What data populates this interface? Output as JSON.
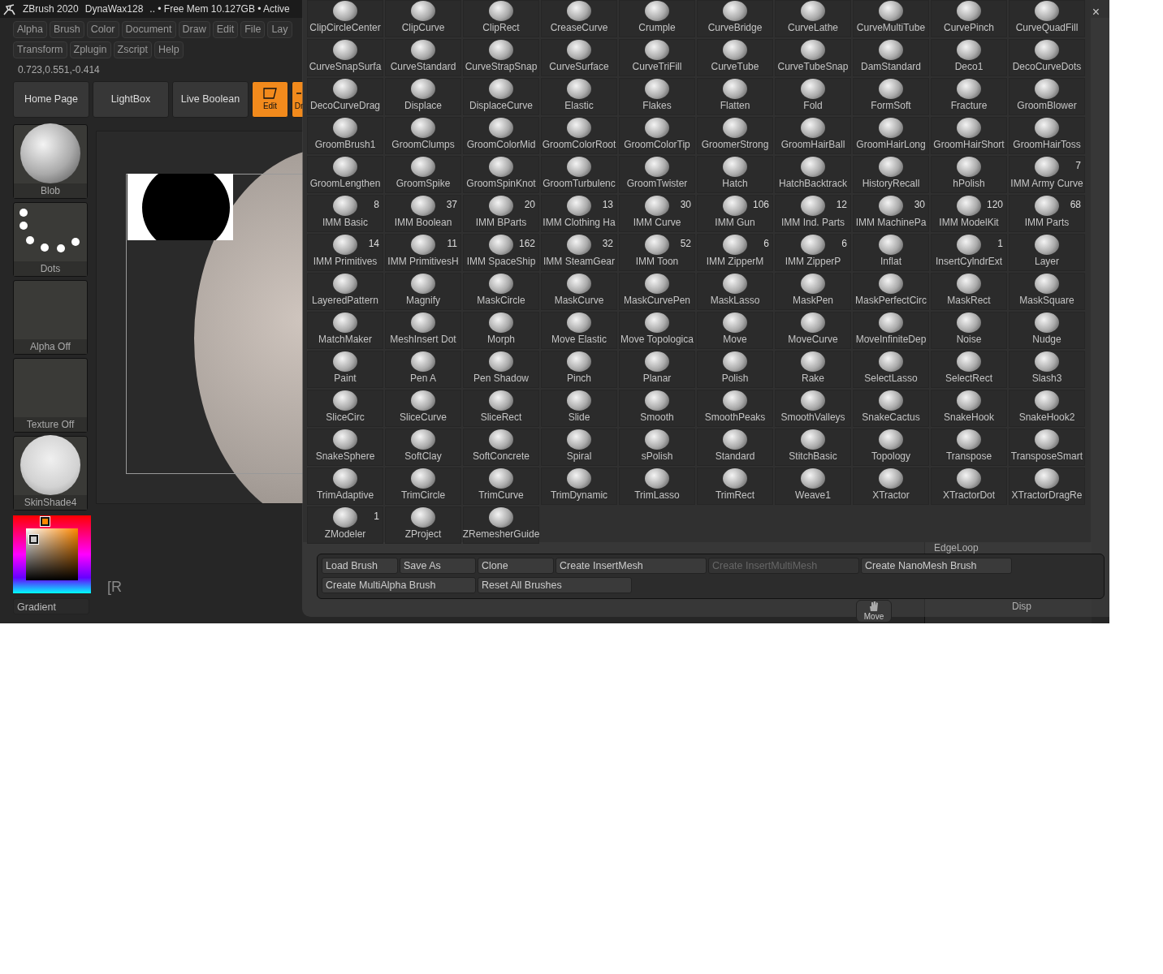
{
  "title_bar": {
    "app": "ZBrush 2020",
    "file": "DynaWax128",
    "status": ".. • Free Mem 10.127GB • Active"
  },
  "menu_rows": [
    {
      "items": [
        "Alpha",
        "Brush",
        "Color",
        "Document",
        "Draw",
        "Edit",
        "File",
        "Lay"
      ]
    },
    {
      "items": [
        "Transform",
        "Zplugin",
        "Zscript",
        "Help"
      ]
    }
  ],
  "coordinates": "0.723,0.551,-0.414",
  "toolbar": [
    {
      "label": "Home Page",
      "kind": "text",
      "selected": false
    },
    {
      "label": "LightBox",
      "kind": "text",
      "selected": false
    },
    {
      "label": "Live Boolean",
      "kind": "text",
      "selected": false
    },
    {
      "label": "Edit",
      "kind": "edit",
      "selected": true
    },
    {
      "label": "Dr",
      "kind": "draw",
      "selected": true
    }
  ],
  "tray": [
    {
      "label": "Blob",
      "kind": "material"
    },
    {
      "label": "Dots",
      "kind": "dots"
    },
    {
      "label": "Alpha Off",
      "kind": "empty"
    },
    {
      "label": "Texture Off",
      "kind": "empty"
    },
    {
      "label": "SkinShade4",
      "kind": "smooth"
    }
  ],
  "color_picker": {
    "label": "Gradient"
  },
  "canvas": {
    "note": "[R"
  },
  "brush_palette": {
    "brushes": [
      {
        "name": "ClipCircleCenter"
      },
      {
        "name": "ClipCurve"
      },
      {
        "name": "ClipRect"
      },
      {
        "name": "CreaseCurve"
      },
      {
        "name": "Crumple"
      },
      {
        "name": "CurveBridge"
      },
      {
        "name": "CurveLathe"
      },
      {
        "name": "CurveMultiTube"
      },
      {
        "name": "CurvePinch"
      },
      {
        "name": "CurveQuadFill"
      },
      {
        "name": "CurveSnapSurfa"
      },
      {
        "name": "CurveStandard"
      },
      {
        "name": "CurveStrapSnap"
      },
      {
        "name": "CurveSurface"
      },
      {
        "name": "CurveTriFill"
      },
      {
        "name": "CurveTube"
      },
      {
        "name": "CurveTubeSnap"
      },
      {
        "name": "DamStandard"
      },
      {
        "name": "Deco1"
      },
      {
        "name": "DecoCurveDots"
      },
      {
        "name": "DecoCurveDrag"
      },
      {
        "name": "Displace"
      },
      {
        "name": "DisplaceCurve"
      },
      {
        "name": "Elastic"
      },
      {
        "name": "Flakes"
      },
      {
        "name": "Flatten"
      },
      {
        "name": "Fold"
      },
      {
        "name": "FormSoft"
      },
      {
        "name": "Fracture"
      },
      {
        "name": "GroomBlower"
      },
      {
        "name": "GroomBrush1"
      },
      {
        "name": "GroomClumps"
      },
      {
        "name": "GroomColorMid"
      },
      {
        "name": "GroomColorRoot"
      },
      {
        "name": "GroomColorTip"
      },
      {
        "name": "GroomerStrong"
      },
      {
        "name": "GroomHairBall"
      },
      {
        "name": "GroomHairLong"
      },
      {
        "name": "GroomHairShort"
      },
      {
        "name": "GroomHairToss"
      },
      {
        "name": "GroomLengthen"
      },
      {
        "name": "GroomSpike"
      },
      {
        "name": "GroomSpinKnot"
      },
      {
        "name": "GroomTurbulenc"
      },
      {
        "name": "GroomTwister"
      },
      {
        "name": "Hatch"
      },
      {
        "name": "HatchBacktrack"
      },
      {
        "name": "HistoryRecall"
      },
      {
        "name": "hPolish"
      },
      {
        "name": "IMM Army Curve",
        "count": "7"
      },
      {
        "name": "IMM Basic",
        "count": "8"
      },
      {
        "name": "IMM Boolean",
        "count": "37"
      },
      {
        "name": "IMM BParts",
        "count": "20"
      },
      {
        "name": "IMM Clothing Ha",
        "count": "13"
      },
      {
        "name": "IMM Curve",
        "count": "30"
      },
      {
        "name": "IMM Gun",
        "count": "106"
      },
      {
        "name": "IMM Ind. Parts",
        "count": "12"
      },
      {
        "name": "IMM MachinePa",
        "count": "30"
      },
      {
        "name": "IMM ModelKit",
        "count": "120"
      },
      {
        "name": "IMM Parts",
        "count": "68"
      },
      {
        "name": "IMM Primitives",
        "count": "14"
      },
      {
        "name": "IMM PrimitivesH",
        "count": "11"
      },
      {
        "name": "IMM SpaceShip",
        "count": "162"
      },
      {
        "name": "IMM SteamGear",
        "count": "32"
      },
      {
        "name": "IMM Toon",
        "count": "52"
      },
      {
        "name": "IMM ZipperM",
        "count": "6"
      },
      {
        "name": "IMM ZipperP",
        "count": "6"
      },
      {
        "name": "Inflat"
      },
      {
        "name": "InsertCylndrExt",
        "count": "1"
      },
      {
        "name": "Layer"
      },
      {
        "name": "LayeredPattern"
      },
      {
        "name": "Magnify"
      },
      {
        "name": "MaskCircle"
      },
      {
        "name": "MaskCurve"
      },
      {
        "name": "MaskCurvePen"
      },
      {
        "name": "MaskLasso"
      },
      {
        "name": "MaskPen"
      },
      {
        "name": "MaskPerfectCirc"
      },
      {
        "name": "MaskRect"
      },
      {
        "name": "MaskSquare"
      },
      {
        "name": "MatchMaker"
      },
      {
        "name": "MeshInsert Dot"
      },
      {
        "name": "Morph"
      },
      {
        "name": "Move Elastic"
      },
      {
        "name": "Move Topologica"
      },
      {
        "name": "Move"
      },
      {
        "name": "MoveCurve"
      },
      {
        "name": "MoveInfiniteDep"
      },
      {
        "name": "Noise"
      },
      {
        "name": "Nudge"
      },
      {
        "name": "Paint"
      },
      {
        "name": "Pen A"
      },
      {
        "name": "Pen Shadow"
      },
      {
        "name": "Pinch"
      },
      {
        "name": "Planar"
      },
      {
        "name": "Polish"
      },
      {
        "name": "Rake"
      },
      {
        "name": "SelectLasso"
      },
      {
        "name": "SelectRect"
      },
      {
        "name": "Slash3"
      },
      {
        "name": "SliceCirc"
      },
      {
        "name": "SliceCurve"
      },
      {
        "name": "SliceRect"
      },
      {
        "name": "Slide"
      },
      {
        "name": "Smooth"
      },
      {
        "name": "SmoothPeaks"
      },
      {
        "name": "SmoothValleys"
      },
      {
        "name": "SnakeCactus"
      },
      {
        "name": "SnakeHook"
      },
      {
        "name": "SnakeHook2"
      },
      {
        "name": "SnakeSphere"
      },
      {
        "name": "SoftClay"
      },
      {
        "name": "SoftConcrete"
      },
      {
        "name": "Spiral"
      },
      {
        "name": "sPolish"
      },
      {
        "name": "Standard"
      },
      {
        "name": "StitchBasic"
      },
      {
        "name": "Topology"
      },
      {
        "name": "Transpose"
      },
      {
        "name": "TransposeSmart"
      },
      {
        "name": "TrimAdaptive"
      },
      {
        "name": "TrimCircle"
      },
      {
        "name": "TrimCurve"
      },
      {
        "name": "TrimDynamic"
      },
      {
        "name": "TrimLasso"
      },
      {
        "name": "TrimRect"
      },
      {
        "name": "Weave1"
      },
      {
        "name": "XTractor"
      },
      {
        "name": "XTractorDot"
      },
      {
        "name": "XTractorDragRe"
      },
      {
        "name": "ZModeler",
        "count": "1"
      },
      {
        "name": "ZProject"
      },
      {
        "name": "ZRemesherGuide"
      }
    ],
    "actions": [
      {
        "label": "Load Brush",
        "disabled": false
      },
      {
        "label": "Save As",
        "disabled": false
      },
      {
        "label": "Clone",
        "disabled": false
      },
      {
        "label": "Create InsertMesh",
        "disabled": false
      },
      {
        "label": "Create InsertMultiMesh",
        "disabled": true
      },
      {
        "label": "Create NanoMesh Brush",
        "disabled": false
      },
      {
        "label": "Create MultiAlpha Brush",
        "disabled": false
      },
      {
        "label": "Reset All Brushes",
        "disabled": false
      }
    ]
  },
  "close_label": "×",
  "background_panel": {
    "items": [
      "EdgeLoop",
      "Disp"
    ],
    "tool": "Move"
  }
}
